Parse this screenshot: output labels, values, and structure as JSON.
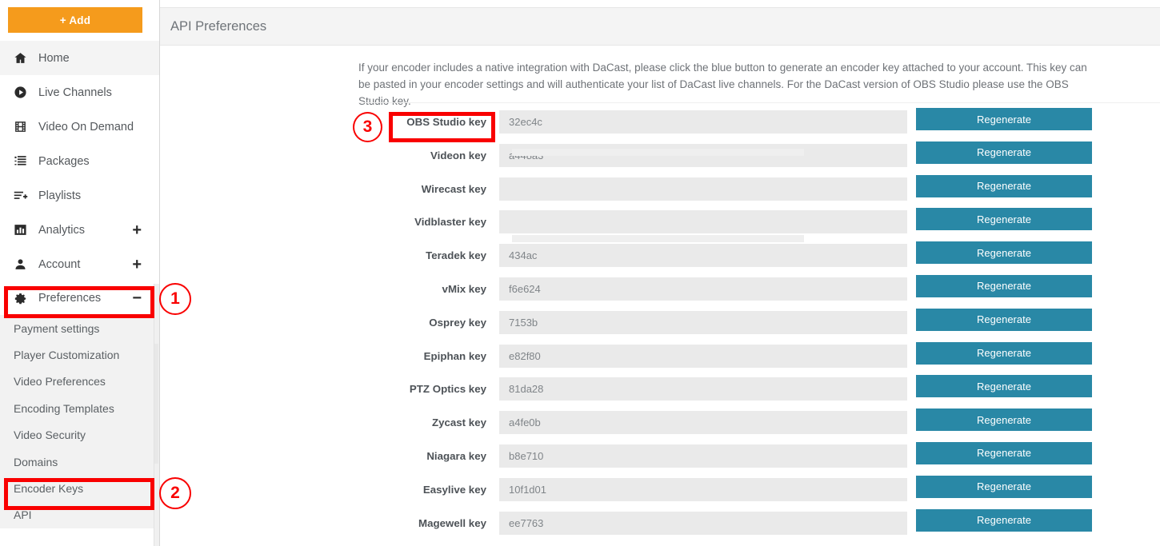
{
  "sidebar": {
    "add_button": "+ Add",
    "nav_items": [
      {
        "label": "Home",
        "icon": "home-icon",
        "active": true,
        "expander": ""
      },
      {
        "label": "Live Channels",
        "icon": "play-circle-icon",
        "active": false,
        "expander": ""
      },
      {
        "label": "Video On Demand",
        "icon": "film-icon",
        "active": false,
        "expander": ""
      },
      {
        "label": "Packages",
        "icon": "package-list-icon",
        "active": false,
        "expander": ""
      },
      {
        "label": "Playlists",
        "icon": "playlist-add-icon",
        "active": false,
        "expander": ""
      },
      {
        "label": "Analytics",
        "icon": "bar-chart-icon",
        "active": false,
        "expander": "+"
      },
      {
        "label": "Account",
        "icon": "person-icon",
        "active": false,
        "expander": "+"
      },
      {
        "label": "Preferences",
        "icon": "gear-icon",
        "active": false,
        "expander": "−"
      }
    ],
    "sub_items": [
      {
        "label": "Payment settings"
      },
      {
        "label": "Player Customization"
      },
      {
        "label": "Video Preferences"
      },
      {
        "label": "Encoding Templates"
      },
      {
        "label": "Video Security"
      },
      {
        "label": "Domains"
      },
      {
        "label": "Encoder Keys"
      },
      {
        "label": "API"
      }
    ]
  },
  "header": {
    "title": "API Preferences"
  },
  "intro": {
    "text": "If your encoder includes a native integration with DaCast, please click the blue button to generate an encoder key attached to your account. This key can be pasted in your encoder settings and will authenticate your list of DaCast live channels. For the DaCast version of OBS Studio please use the OBS Studio key."
  },
  "keys": {
    "regenerate_label": "Regenerate",
    "rows": [
      {
        "label": "OBS Studio key",
        "value": "32ec4c"
      },
      {
        "label": "Videon key",
        "value": "a448a3"
      },
      {
        "label": "Wirecast key",
        "value": ""
      },
      {
        "label": "Vidblaster key",
        "value": ""
      },
      {
        "label": "Teradek key",
        "value": "434ac"
      },
      {
        "label": "vMix key",
        "value": "f6e624"
      },
      {
        "label": "Osprey key",
        "value": "7153b"
      },
      {
        "label": "Epiphan key",
        "value": "e82f80"
      },
      {
        "label": "PTZ Optics key",
        "value": "81da28"
      },
      {
        "label": "Zycast key",
        "value": "a4fe0b"
      },
      {
        "label": "Niagara key",
        "value": "b8e710"
      },
      {
        "label": "Easylive key",
        "value": "10f1d01"
      },
      {
        "label": "Magewell key",
        "value": "ee7763"
      }
    ]
  },
  "annotations": {
    "markers": [
      {
        "number": "1"
      },
      {
        "number": "2"
      },
      {
        "number": "3"
      }
    ]
  },
  "colors": {
    "accent_orange": "#f59b1c",
    "button_teal": "#2988a6",
    "annotation_red": "#f90000",
    "field_gray": "#eaeaea"
  }
}
